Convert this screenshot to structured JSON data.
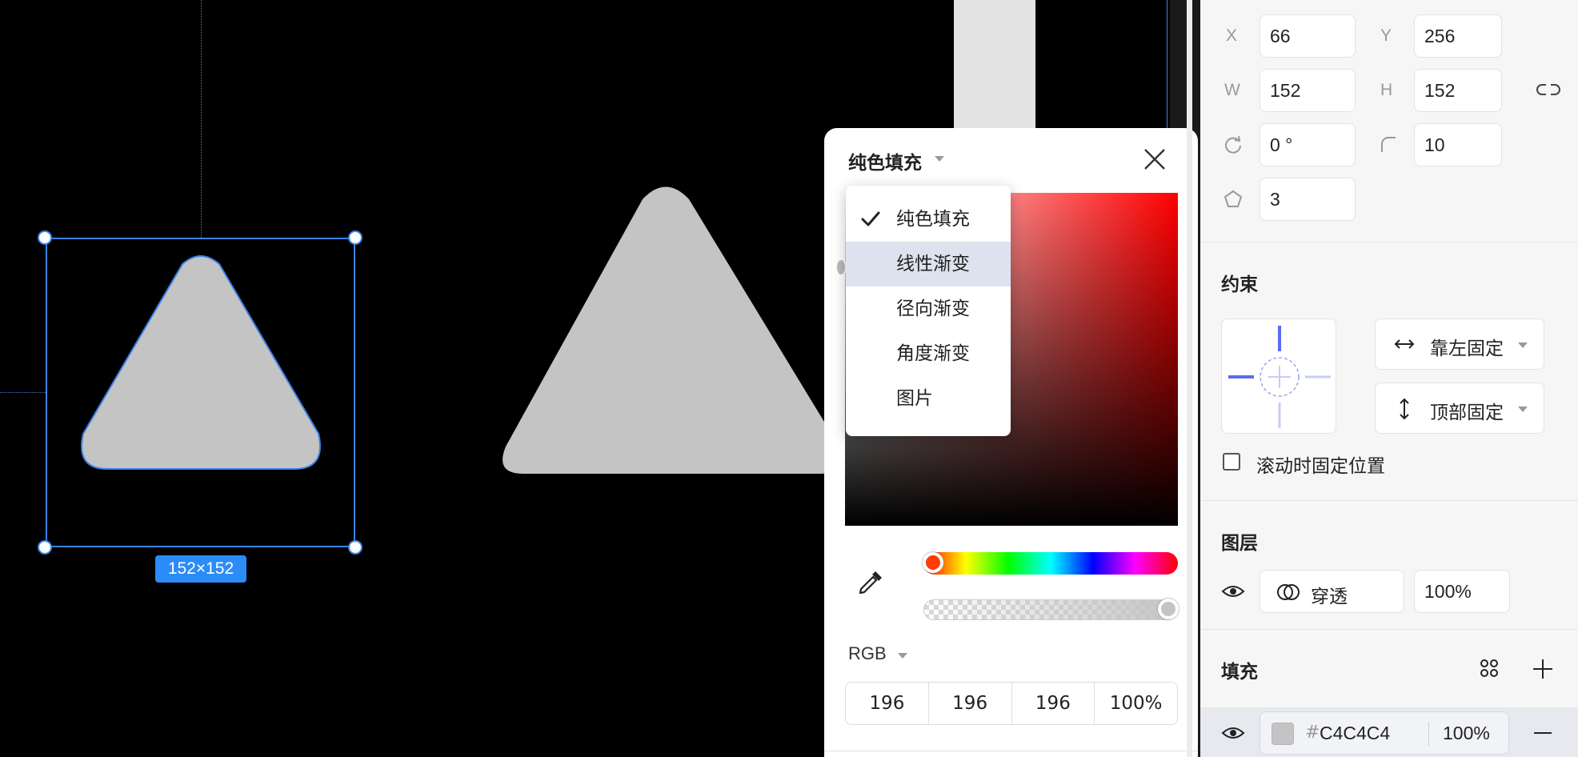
{
  "canvas": {
    "selection_size": "152×152",
    "shape_fill_color": "#C4C4C4",
    "selection_color": "#3B82E6"
  },
  "color_popup": {
    "title": "纯色填充",
    "menu_items": [
      {
        "label": "纯色填充",
        "checked": true
      },
      {
        "label": "线性渐变",
        "hovered": true
      },
      {
        "label": "径向渐变"
      },
      {
        "label": "角度渐变"
      },
      {
        "label": "图片"
      }
    ],
    "mode": "RGB",
    "r": "196",
    "g": "196",
    "b": "196",
    "alpha": "100%"
  },
  "panel": {
    "x_label": "X",
    "x": "66",
    "y_label": "Y",
    "y": "256",
    "w_label": "W",
    "w": "152",
    "h_label": "H",
    "h": "152",
    "rotation": "0 °",
    "radius": "10",
    "points": "3",
    "constraints": {
      "title": "约束",
      "horizontal": "靠左固定",
      "vertical": "顶部固定",
      "fix_on_scroll": "滚动时固定位置"
    },
    "layer": {
      "title": "图层",
      "blend": "穿透",
      "opacity": "100%"
    },
    "fill": {
      "title": "填充",
      "hex": "C4C4C4",
      "opacity": "100%",
      "swatch_color": "#C4C4C4"
    }
  }
}
